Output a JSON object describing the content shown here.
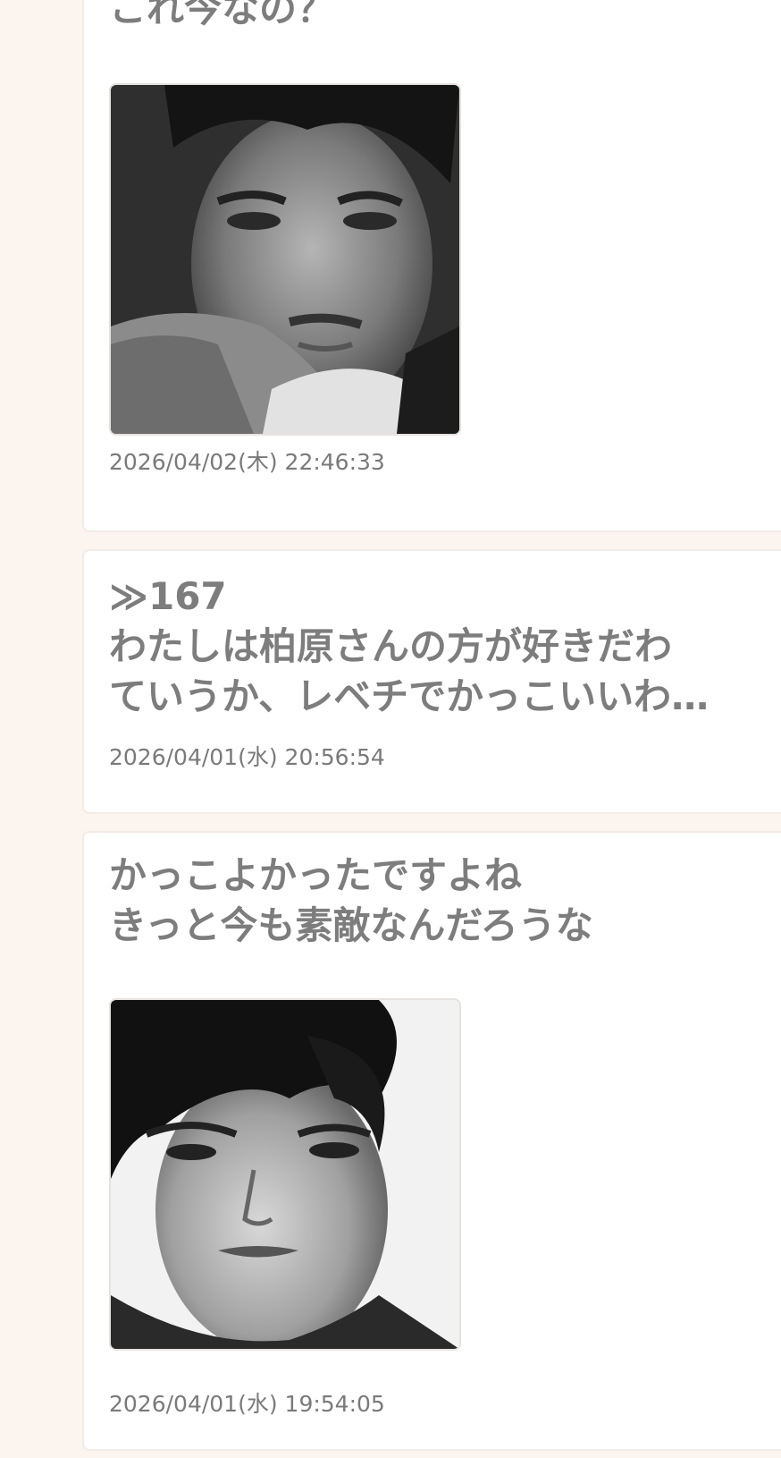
{
  "posts": [
    {
      "lines": [
        "これ今なの？"
      ],
      "has_image": true,
      "image_alt": "portrait-man-1",
      "timestamp": "2026/04/02(木) 22:46:33"
    },
    {
      "lines": [
        "≫167",
        "わたしは柏原さんの方が好きだわ",
        "ていうか、レベチでかっこいいわ…"
      ],
      "has_image": false,
      "timestamp": "2026/04/01(水) 20:56:54"
    },
    {
      "lines": [
        "かっこよかったですよね",
        "きっと今も素敵なんだろうな"
      ],
      "has_image": true,
      "image_alt": "portrait-man-2",
      "timestamp": "2026/04/01(水) 19:54:05"
    }
  ],
  "colors": {
    "page_background": "#fbf4ef",
    "card_background": "#ffffff",
    "text": "#7d7d7d"
  }
}
